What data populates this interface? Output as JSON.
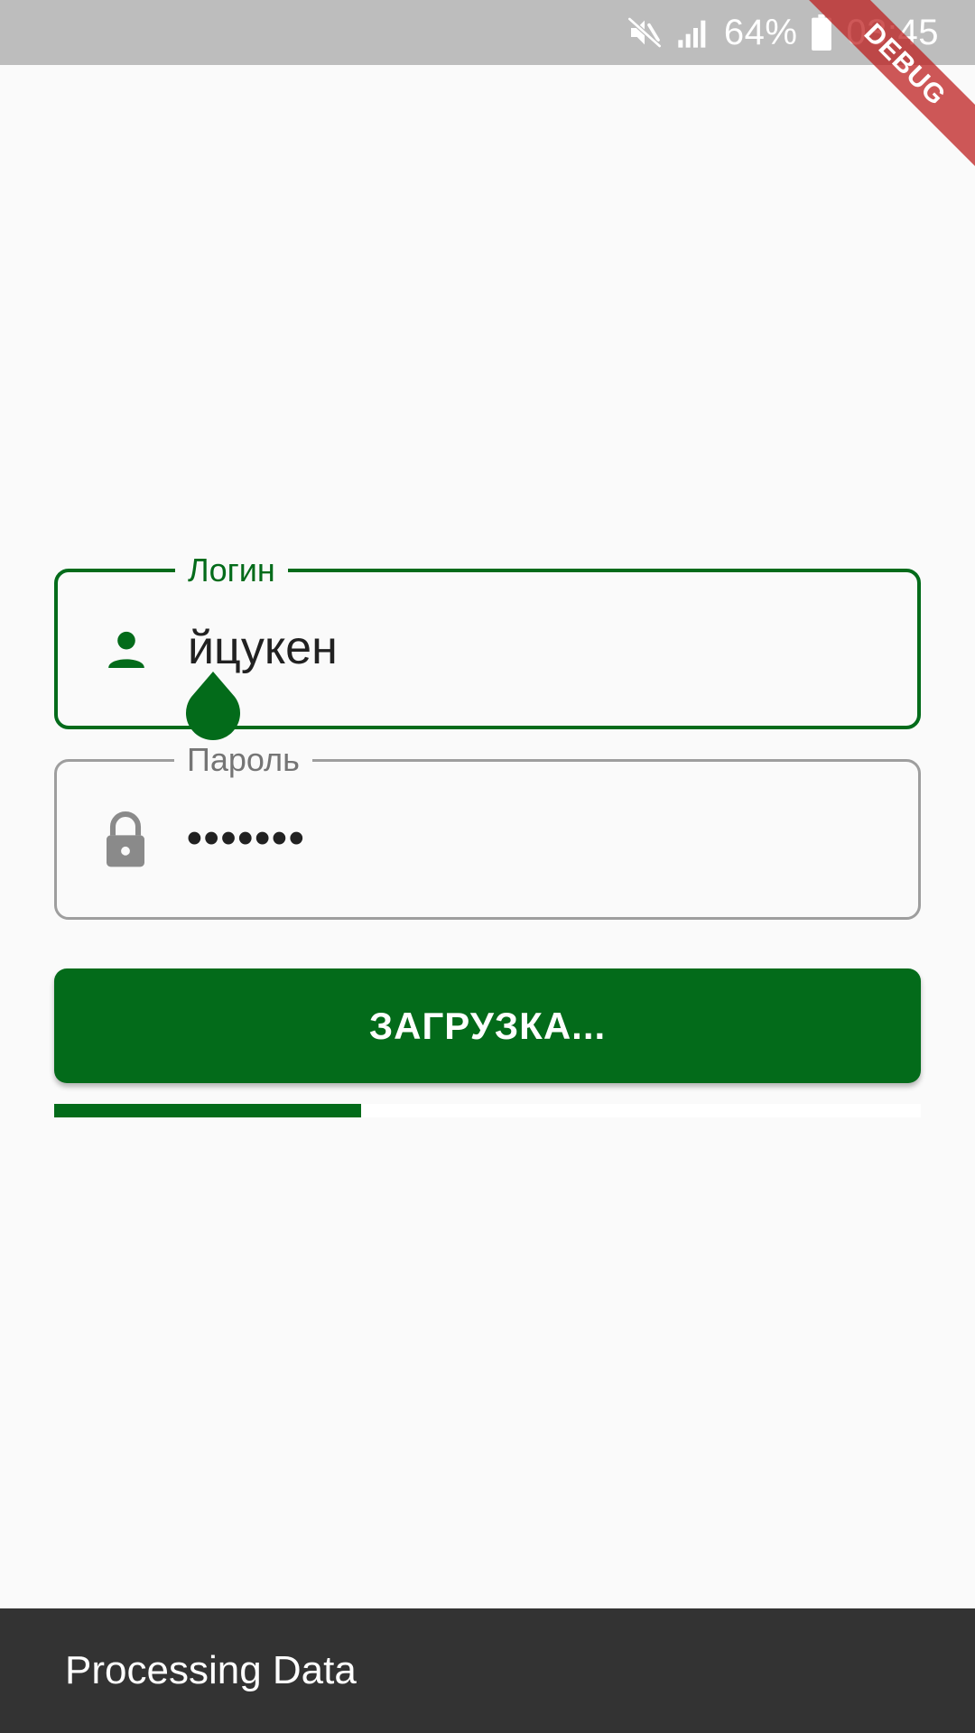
{
  "status_bar": {
    "battery_percent": "64%",
    "time": "03:45",
    "icons": [
      "mute-icon",
      "signal-icon",
      "battery-icon"
    ]
  },
  "debug_banner": {
    "label": "DEBUG"
  },
  "login_field": {
    "label": "Логин",
    "value": "йцукен",
    "icon": "person-icon"
  },
  "password_field": {
    "label": "Пароль",
    "value": "•••••••",
    "icon": "lock-icon"
  },
  "submit_button": {
    "label": "ЗАГРУЗКА..."
  },
  "progress": {
    "value": 0.354
  },
  "snackbar": {
    "message": "Processing Data"
  },
  "colors": {
    "accent": "#036b1a",
    "status_bar": "#bdbdbd",
    "snackbar": "#333333",
    "inactive_border": "#9e9e9e"
  }
}
